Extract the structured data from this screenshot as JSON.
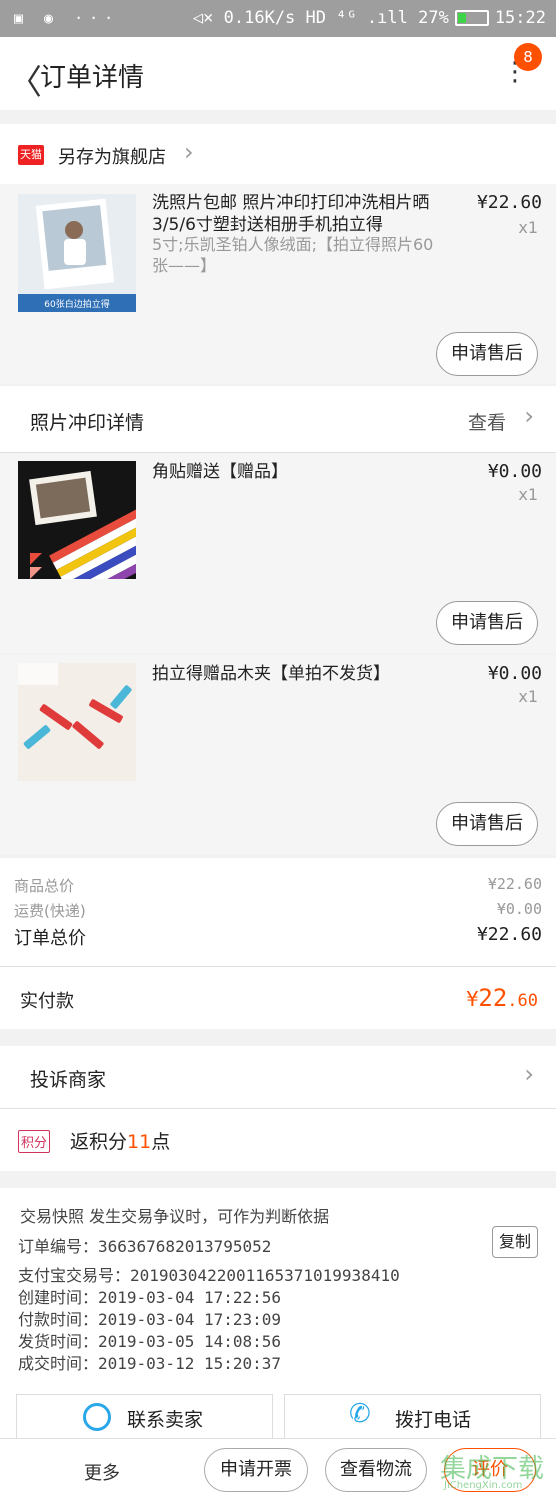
{
  "status_bar": {
    "left": "▣ ◉ ···",
    "right": "◁× 0.16K/s HD ⁴ᴳ .ıll 27%",
    "time": "15:22",
    "battery_percent": 27
  },
  "header": {
    "title": "订单详情",
    "back_glyph": "〈",
    "menu_badge": "8"
  },
  "store": {
    "badge": "天猫",
    "name": "另存为旗舰店"
  },
  "main_item": {
    "title": "洗照片包邮 照片冲印打印冲洗相片晒3/5/6寸塑封送相册手机拍立得",
    "spec": "5寸;乐凯圣铂人像绒面;【拍立得照片60张——】",
    "price": "¥22.60",
    "qty": "x1",
    "thumb_caption": "60张白边拍立得",
    "after_sale": "申请售后"
  },
  "photo_detail": {
    "label": "照片冲印详情",
    "action": "查看"
  },
  "gift_items": [
    {
      "title": "角贴赠送【赠品】",
      "price": "¥0.00",
      "qty": "x1",
      "after_sale": "申请售后"
    },
    {
      "title": "拍立得赠品木夹【单拍不发货】",
      "price": "¥0.00",
      "qty": "x1",
      "after_sale": "申请售后"
    }
  ],
  "summary": {
    "goods_label": "商品总价",
    "goods_value": "¥22.60",
    "shipping_label": "运费(快递)",
    "shipping_value": "¥0.00",
    "order_total_label": "订单总价",
    "order_total_value": "¥22.60",
    "paid_label": "实付款",
    "paid_yen": "¥",
    "paid_int": "22",
    "paid_dec": ".60"
  },
  "complain": {
    "label": "投诉商家"
  },
  "points": {
    "badge": "积分",
    "prefix": "返积分",
    "number": "11",
    "suffix": "点"
  },
  "snapshot": {
    "title": "交易快照 发生交易争议时，可作为判断依据",
    "order_no": "订单编号：366367682013795052",
    "copy": "复制",
    "alipay_no": "支付宝交易号：2019030422001165371019938410",
    "created": "创建时间：2019-03-04 17:22:56",
    "paid": "付款时间：2019-03-04 17:23:09",
    "shipped": "发货时间：2019-03-05 14:08:56",
    "completed": "成交时间：2019-03-12 15:20:37"
  },
  "contact": {
    "seller": "联系卖家",
    "phone": "拨打电话"
  },
  "bottom_bar": {
    "more": "更多",
    "invoice": "申请开票",
    "logistics": "查看物流",
    "review": "评价"
  },
  "watermark": {
    "text": "集成下载",
    "url": "JiChengXin.com"
  },
  "colors": {
    "accent": "#ff5000",
    "tmall": "#e22222",
    "points": "#d2335c"
  }
}
